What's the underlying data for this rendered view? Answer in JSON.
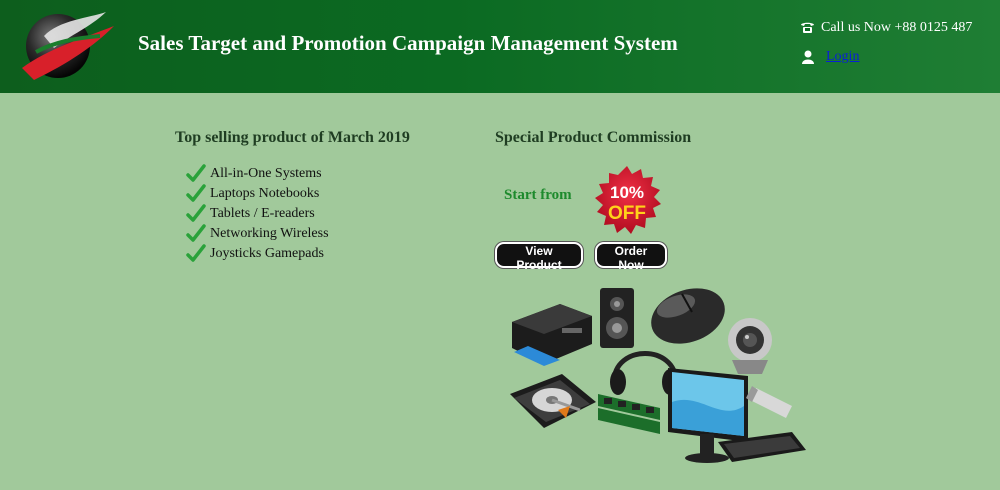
{
  "header": {
    "title": "Sales Target and Promotion Campaign Management System",
    "phone_text": "Call us Now +88 0125 487",
    "login_label": "Login",
    "phone_icon": "phone-icon",
    "user_icon": "user-icon"
  },
  "top_selling": {
    "title": "Top selling product of March 2019",
    "items": [
      {
        "label": "All-in-One Systems"
      },
      {
        "label": "Laptops Notebooks"
      },
      {
        "label": "Tablets / E-readers"
      },
      {
        "label": "Networking Wireless"
      },
      {
        "label": "Joysticks Gamepads"
      }
    ]
  },
  "commission": {
    "title": "Special Product Commission",
    "start_from": "Start from",
    "badge_percent": "10%",
    "badge_word": "OFF",
    "view_product_label": "View Product",
    "order_now_label": "Order Now"
  },
  "colors": {
    "header_green": "#0b6a22",
    "page_background": "#a1c99b",
    "check_green": "#2aa23a",
    "badge_red": "#d0142b",
    "badge_yellow": "#ffd21a"
  }
}
